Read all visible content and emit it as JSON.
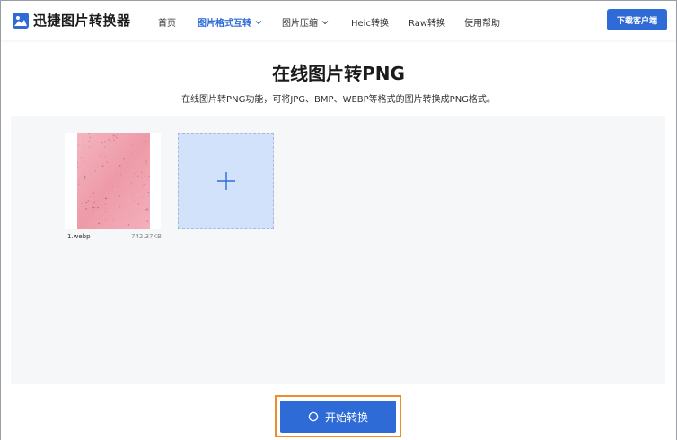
{
  "header": {
    "brand": "迅捷图片转换器",
    "nav": [
      {
        "label": "首页",
        "active": false,
        "dropdown": false
      },
      {
        "label": "图片格式互转",
        "active": true,
        "dropdown": true
      },
      {
        "label": "图片压缩",
        "active": false,
        "dropdown": true
      },
      {
        "label": "Heic转换",
        "active": false,
        "dropdown": false
      },
      {
        "label": "Raw转换",
        "active": false,
        "dropdown": false
      },
      {
        "label": "使用帮助",
        "active": false,
        "dropdown": false
      }
    ],
    "download_label": "下载客户端"
  },
  "main": {
    "title": "在线图片转PNG",
    "subtitle": "在线图片转PNG功能，可将JPG、BMP、WEBP等格式的图片转换成PNG格式。"
  },
  "files": [
    {
      "name": "1.webp",
      "size": "742.37KB"
    }
  ],
  "start_label": "开始转换",
  "colors": {
    "accent": "#2f6bd6",
    "highlight": "#f08c28",
    "add_tile": "#d3e2fb"
  },
  "icons": {
    "logo": "image-icon",
    "add": "plus-icon",
    "start": "loading-ring-icon"
  }
}
